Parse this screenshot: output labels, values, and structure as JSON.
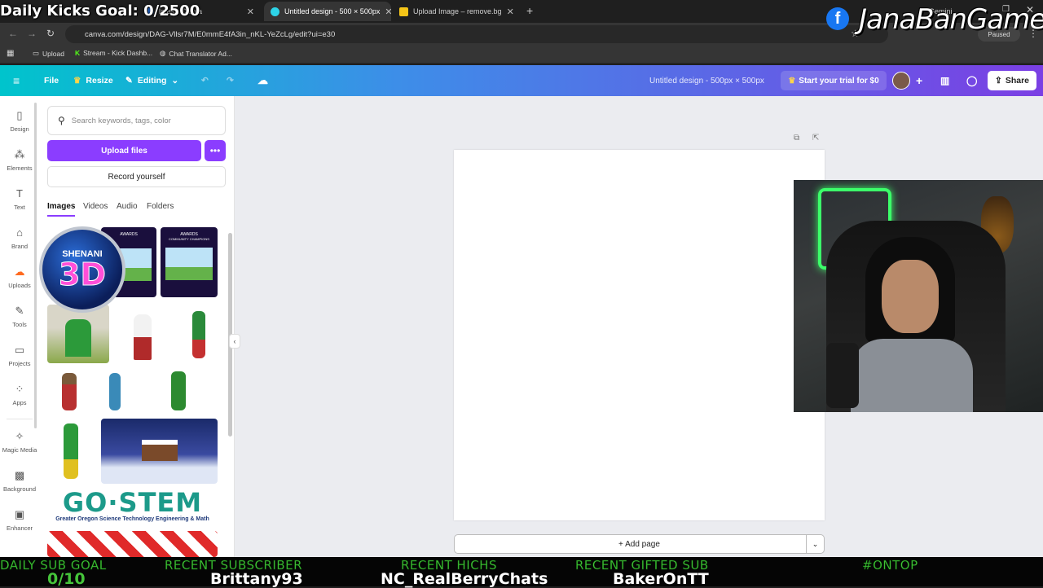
{
  "overlay_top": {
    "goal": "Daily Kicks Goal: 0/2500",
    "brand": "JanaBanGames"
  },
  "browser": {
    "tabs": [
      {
        "label": "lates - Canva",
        "active": false
      },
      {
        "label": "Untitled design - 500 × 500px",
        "active": true
      },
      {
        "label": "Upload Image – remove.bg",
        "active": false
      }
    ],
    "url": "canva.com/design/DAG-Vllsr7M/E0mmE4fA3in_nKL-YeZcLg/edit?ui=e30",
    "profile": "Gemini",
    "paused": "Paused",
    "bookmarks": [
      {
        "label": "Upload"
      },
      {
        "label": "Stream - Kick Dashb..."
      },
      {
        "label": "Chat Translator Ad..."
      }
    ]
  },
  "canva": {
    "file": "File",
    "resize": "Resize",
    "editing": "Editing",
    "doc_title": "Untitled design - 500px × 500px",
    "trial": "Start your trial for $0",
    "share": "Share",
    "accent": "#8b3dff"
  },
  "rail": [
    {
      "label": "Design",
      "icon": "design-icon"
    },
    {
      "label": "Elements",
      "icon": "elements-icon"
    },
    {
      "label": "Text",
      "icon": "text-icon"
    },
    {
      "label": "Brand",
      "icon": "brand-icon"
    },
    {
      "label": "Uploads",
      "icon": "uploads-icon"
    },
    {
      "label": "Tools",
      "icon": "tools-icon"
    },
    {
      "label": "Projects",
      "icon": "projects-icon"
    },
    {
      "label": "Apps",
      "icon": "apps-icon"
    },
    {
      "label": "Magic Media",
      "icon": "magic-media-icon"
    },
    {
      "label": "Background",
      "icon": "background-icon"
    },
    {
      "label": "Enhancer",
      "icon": "enhancer-icon"
    }
  ],
  "panel": {
    "search_placeholder": "Search keywords, tags, color",
    "upload": "Upload files",
    "record": "Record yourself",
    "tabs": [
      "Images",
      "Videos",
      "Audio",
      "Folders"
    ],
    "thumb_texts": {
      "awards": "AWARDS",
      "champions": "COMMUNITY CHAMPIONS",
      "gostem": "GO·STEM",
      "gostem_sub": "Greater Oregon Science Technology Engineering & Math",
      "shenani": "SHENANI",
      "threed": "3D"
    }
  },
  "canvas": {
    "add_page": "+ Add page"
  },
  "overlay_bottom": [
    {
      "label": "DAILY SUB GOAL",
      "value": "0/10"
    },
    {
      "label": "RECENT SUBSCRIBER",
      "value": "Brittany93"
    },
    {
      "label": "RECENT HICHS",
      "value": "NC_RealBerryChats"
    },
    {
      "label": "RECENT GIFTED SUB",
      "value": "BakerOnTT"
    },
    {
      "label": "#ONTOP",
      "value": ""
    }
  ]
}
